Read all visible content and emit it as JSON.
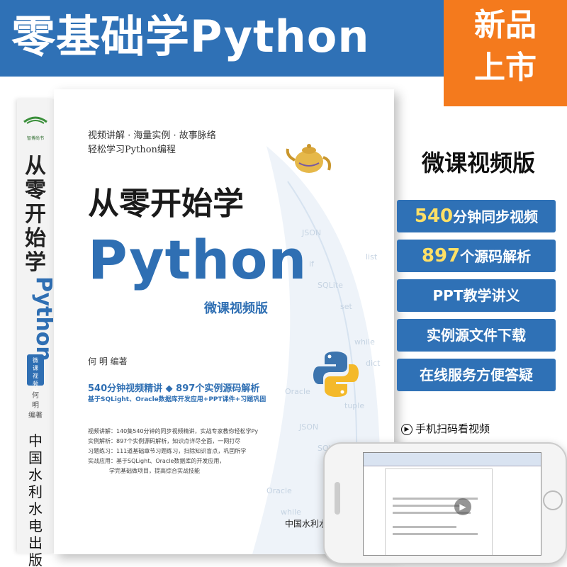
{
  "header": {
    "title": "零基础学Python",
    "badge_line1": "新品",
    "badge_line2": "上市"
  },
  "spine": {
    "logo_text": "智博尚书",
    "title": "从零开始学",
    "python": "Python",
    "edition": "微课视频版",
    "author": "何 明 编著",
    "publisher": "中国水利水电出版社"
  },
  "cover": {
    "tagline_line1": "视频讲解 · 海量实例 · 故事脉络",
    "tagline_line2": "轻松学习Python编程",
    "cn_title": "从零开始学",
    "python": "Python",
    "edition": "微课视频版",
    "author": "何 明 编著",
    "features_line1": "540分钟视频精讲 ◆ 897个实例源码解析",
    "features_line2": "基于SQLight、Oracle数据库开发应用+PPT课件+习题巩固",
    "blurb": [
      "视频讲解：140集540分钟的同步视频精讲，实战专家教你轻松学Python",
      "实例解析：897个实例源码解析，知识点详尽全面，一网打尽",
      "习题练习：111道基础章节习题练习，扫除知识盲点，巩固所学",
      "实战应用：基于SQLight、Oracle数据库的开发应用，",
      "学完基础做项目，提高综合实战技能"
    ],
    "publisher": "中国水利水电出版社",
    "background_words": [
      "JSON",
      "SQLite",
      "Oracle",
      "while",
      "tuple",
      "list",
      "set",
      "if",
      "dict",
      "JSON",
      "SQLite",
      "Oracle",
      "while",
      "tuple",
      "if"
    ]
  },
  "side": {
    "video_edition": "微课视频版",
    "features": [
      {
        "num": "540",
        "text": "分钟同步视频"
      },
      {
        "num": "897",
        "text": "个源码解析"
      },
      {
        "num": "",
        "text": "PPT教学讲义"
      },
      {
        "num": "",
        "text": "实例源文件下载"
      },
      {
        "num": "",
        "text": "在线服务方便答疑"
      }
    ],
    "scan_text": "手机扫码看视频"
  },
  "colors": {
    "brand_blue": "#2f71b6",
    "badge_orange": "#f47a1d",
    "accent_yellow": "#ffe066"
  },
  "icons": {
    "scan": "play-circle-icon",
    "teapot": "teapot-icon",
    "python_logo": "python-logo-icon"
  }
}
